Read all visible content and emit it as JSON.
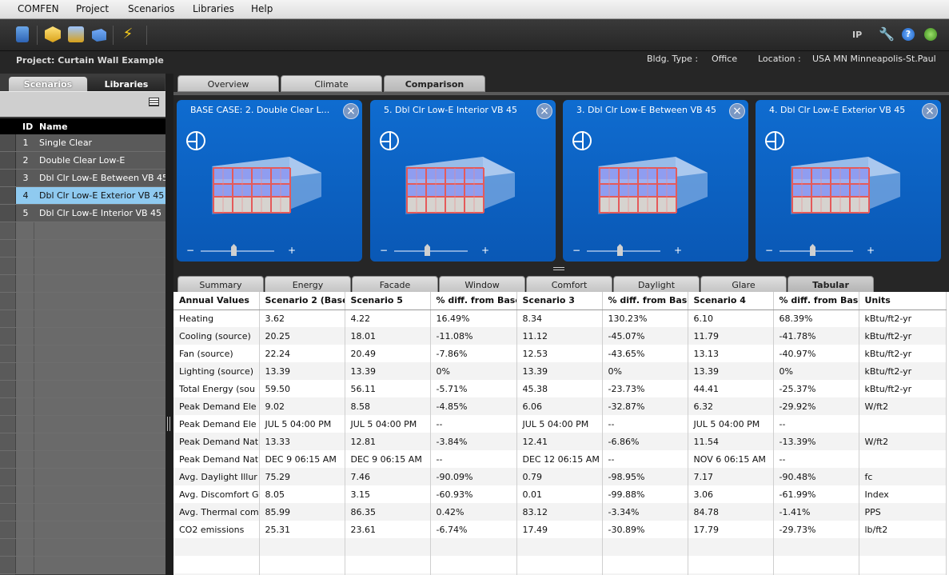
{
  "menubar": {
    "items": [
      "COMFEN",
      "Project",
      "Scenarios",
      "Libraries",
      "Help"
    ]
  },
  "toolbar": {
    "unit_label": "IP"
  },
  "info": {
    "project": "Project: Curtain Wall Example",
    "bldg_type_label": "Bldg. Type :",
    "bldg_type": "Office",
    "location_label": "Location :",
    "location": "USA MN Minneapolis-St.Paul"
  },
  "left": {
    "tabs": [
      "Scenarios",
      "Libraries"
    ],
    "header_id": "ID",
    "header_name": "Name",
    "rows": [
      {
        "id": "1",
        "name": "Single Clear"
      },
      {
        "id": "2",
        "name": "Double Clear Low-E"
      },
      {
        "id": "3",
        "name": "Dbl Clr Low-E Between VB 45"
      },
      {
        "id": "4",
        "name": "Dbl Clr Low-E Exterior VB 45"
      },
      {
        "id": "5",
        "name": "Dbl Clr Low-E Interior VB 45"
      }
    ],
    "selected_row": "4"
  },
  "main": {
    "tabs": [
      "Overview",
      "Climate",
      "Comparison"
    ],
    "active_tab": "Comparison",
    "cards": [
      {
        "title": "BASE CASE: 2. Double Clear L..."
      },
      {
        "title": "5. Dbl Clr Low-E Interior VB 45"
      },
      {
        "title": "3. Dbl Clr Low-E Between VB 45"
      },
      {
        "title": "4. Dbl Clr Low-E Exterior VB 45"
      }
    ],
    "subtabs": [
      "Summary",
      "Energy",
      "Facade",
      "Window",
      "Comfort",
      "Daylight",
      "Glare",
      "Tabular"
    ],
    "active_subtab": "Tabular"
  },
  "table": {
    "headers": [
      "Annual Values",
      "Scenario 2 (Base",
      "Scenario 5",
      "% diff. from Base",
      "Scenario 3",
      "% diff. from Base",
      "Scenario 4",
      "% diff. from Base",
      "Units"
    ],
    "rows": [
      [
        "Heating",
        "3.62",
        "4.22",
        "16.49%",
        "8.34",
        "130.23%",
        "6.10",
        "68.39%",
        "kBtu/ft2-yr"
      ],
      [
        "Cooling (source)",
        "20.25",
        "18.01",
        "-11.08%",
        "11.12",
        "-45.07%",
        "11.79",
        "-41.78%",
        "kBtu/ft2-yr"
      ],
      [
        "Fan (source)",
        "22.24",
        "20.49",
        "-7.86%",
        "12.53",
        "-43.65%",
        "13.13",
        "-40.97%",
        "kBtu/ft2-yr"
      ],
      [
        "Lighting (source)",
        "13.39",
        "13.39",
        "0%",
        "13.39",
        "0%",
        "13.39",
        "0%",
        "kBtu/ft2-yr"
      ],
      [
        "Total Energy (sou",
        "59.50",
        "56.11",
        "-5.71%",
        "45.38",
        "-23.73%",
        "44.41",
        "-25.37%",
        "kBtu/ft2-yr"
      ],
      [
        "Peak Demand Ele",
        "9.02",
        "8.58",
        "-4.85%",
        "6.06",
        "-32.87%",
        "6.32",
        "-29.92%",
        "W/ft2"
      ],
      [
        "Peak Demand Ele",
        "JUL 5 04:00 PM",
        "JUL 5 04:00 PM",
        "--",
        "JUL 5 04:00 PM",
        "--",
        "JUL 5 04:00 PM",
        "--",
        ""
      ],
      [
        "Peak Demand Nat",
        "13.33",
        "12.81",
        "-3.84%",
        "12.41",
        "-6.86%",
        "11.54",
        "-13.39%",
        "W/ft2"
      ],
      [
        "Peak Demand Nat",
        "DEC 9 06:15 AM",
        "DEC 9 06:15 AM",
        "--",
        "DEC 12 06:15 AM",
        "--",
        "NOV 6 06:15 AM",
        "--",
        ""
      ],
      [
        "Avg. Daylight Illur",
        "75.29",
        "7.46",
        "-90.09%",
        "0.79",
        "-98.95%",
        "7.17",
        "-90.48%",
        "fc"
      ],
      [
        "Avg. Discomfort G",
        "8.05",
        "3.15",
        "-60.93%",
        "0.01",
        "-99.88%",
        "3.06",
        "-61.99%",
        "Index"
      ],
      [
        "Avg. Thermal com",
        "85.99",
        "86.35",
        "0.42%",
        "83.12",
        "-3.34%",
        "84.78",
        "-1.41%",
        "PPS"
      ],
      [
        "CO2 emissions",
        "25.31",
        "23.61",
        "-6.74%",
        "17.49",
        "-30.89%",
        "17.79",
        "-29.73%",
        "lb/ft2"
      ]
    ]
  },
  "colors": {
    "card_blue": "#0f6cd0",
    "selected_row": "#8fcaf0",
    "accent": "#1a1a1a"
  }
}
